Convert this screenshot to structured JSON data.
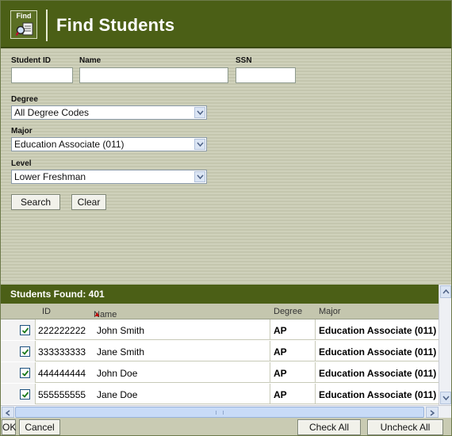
{
  "header": {
    "find_tile_label": "Find",
    "find_icon": "find-students-icon",
    "title": "Find Students",
    "color": "#4b5f16"
  },
  "search": {
    "student_id_label": "Student ID",
    "name_label": "Name",
    "ssn_label": "SSN",
    "student_id_value": "",
    "name_value": "",
    "ssn_value": "",
    "degree_label": "Degree",
    "degree_value": "All Degree Codes",
    "major_label": "Major",
    "major_value": "Education Associate (011)",
    "level_label": "Level",
    "level_value": "Lower Freshman",
    "search_button": "Search",
    "clear_button": "Clear"
  },
  "results": {
    "found_label": "Students Found: 401",
    "columns": {
      "id": "ID",
      "name": "Name",
      "sort_indicator": "▲",
      "degree": "Degree",
      "major": "Major"
    },
    "rows": [
      {
        "checked": true,
        "id": "222222222",
        "name": "John Smith",
        "degree": "AP",
        "major": "Education Associate (011)"
      },
      {
        "checked": true,
        "id": "333333333",
        "name": "Jane Smith",
        "degree": "AP",
        "major": "Education Associate (011)"
      },
      {
        "checked": true,
        "id": "444444444",
        "name": "John Doe",
        "degree": "AP",
        "major": "Education Associate (011)"
      },
      {
        "checked": true,
        "id": "555555555",
        "name": "Jane Doe",
        "degree": "AP",
        "major": "Education Associate (011)"
      }
    ]
  },
  "footer": {
    "ok_button": "OK",
    "cancel_button": "Cancel",
    "check_all_button": "Check All",
    "uncheck_all_button": "Uncheck All"
  }
}
